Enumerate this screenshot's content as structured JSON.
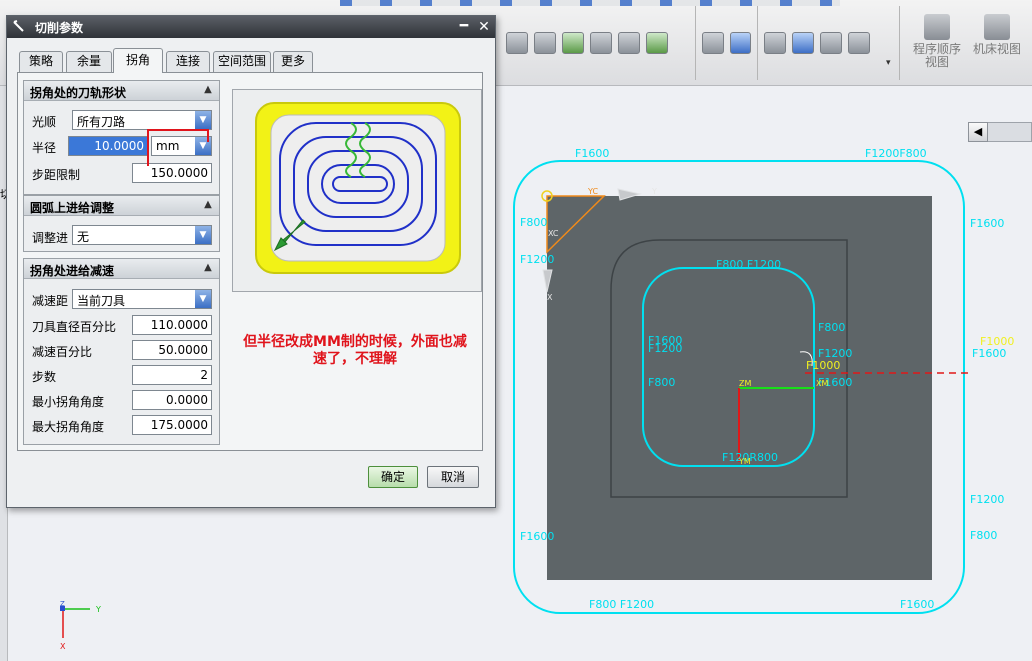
{
  "dialog": {
    "title": "切削参数",
    "minimize_glyph": "━",
    "close_glyph": "✕"
  },
  "tabs": [
    {
      "label": "策略"
    },
    {
      "label": "余量"
    },
    {
      "label": "拐角",
      "active": true
    },
    {
      "label": "连接"
    },
    {
      "label": "空间范围"
    },
    {
      "label": "更多"
    }
  ],
  "corner_shape": {
    "title": "拐角处的刀轨形状",
    "smoothing_label": "光顺",
    "smoothing_value": "所有刀路",
    "radius_label": "半径",
    "radius_value": "10.0000",
    "radius_unit": "mm",
    "step_limit_label": "步距限制",
    "step_limit_value": "150.0000"
  },
  "arc_feed": {
    "title": "圆弧上进给调整",
    "adjust_label": "调整进",
    "adjust_value": "无"
  },
  "corner_slowdown": {
    "title": "拐角处进给减速",
    "slowdown_distance_label": "减速距",
    "slowdown_distance_value": "当前刀具",
    "tool_diameter_pct_label": "刀具直径百分比",
    "tool_diameter_pct_value": "110.0000",
    "slowdown_pct_label": "减速百分比",
    "slowdown_pct_value": "50.0000",
    "steps_label": "步数",
    "steps_value": "2",
    "min_angle_label": "最小拐角角度",
    "min_angle_value": "0.0000",
    "max_angle_label": "最大拐角角度",
    "max_angle_value": "175.0000"
  },
  "annotation": "但半径改成MM制的时候，外面也减速了，不理解",
  "buttons": {
    "ok": "确定",
    "cancel": "取消"
  },
  "toolbar": {
    "program_order_view": "程序顺序视图",
    "machine_tool_view": "机床视图",
    "dropdown_glyph": "▾",
    "left_char": "切"
  },
  "collapse_glyph": "◀",
  "canvas_labels": {
    "f1600": "F1600",
    "f1200": "F1200",
    "f800": "F800",
    "f1000": "F1000",
    "f1200_f800": "F1200F800",
    "f800_f1200": "F800 F1200",
    "f1200r800": "F120R800",
    "zm": "ZM",
    "xm": "XM",
    "ym": "YM",
    "xc": "XC",
    "yc": "YC",
    "y": "Y",
    "x": "X",
    "z": "Z"
  },
  "colors": {
    "toolpath": "#00e0f0",
    "part_face": "#5e6568",
    "annotation": "#e0141c",
    "selection": "#3b78d8"
  }
}
